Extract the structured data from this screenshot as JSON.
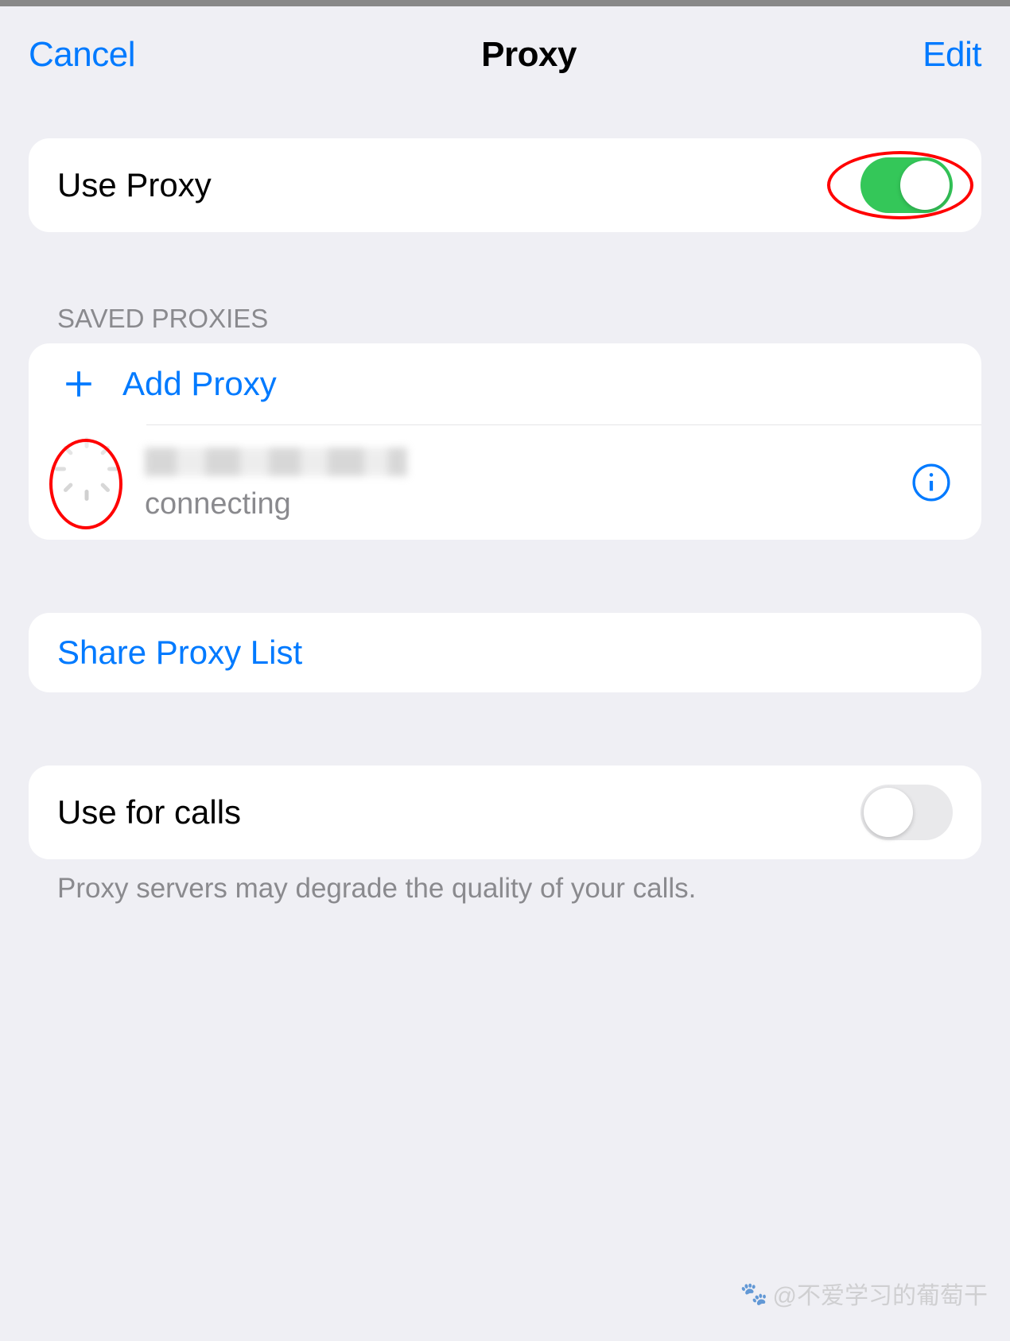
{
  "nav": {
    "cancel": "Cancel",
    "title": "Proxy",
    "edit": "Edit"
  },
  "useProxy": {
    "label": "Use Proxy",
    "enabled": true
  },
  "savedProxies": {
    "header": "SAVED PROXIES",
    "addLabel": "Add Proxy",
    "entries": [
      {
        "status": "connecting"
      }
    ]
  },
  "share": {
    "label": "Share Proxy List"
  },
  "useForCalls": {
    "label": "Use for calls",
    "enabled": false,
    "footer": "Proxy servers may degrade the quality of your calls."
  },
  "watermark": "@不爱学习的葡萄干"
}
